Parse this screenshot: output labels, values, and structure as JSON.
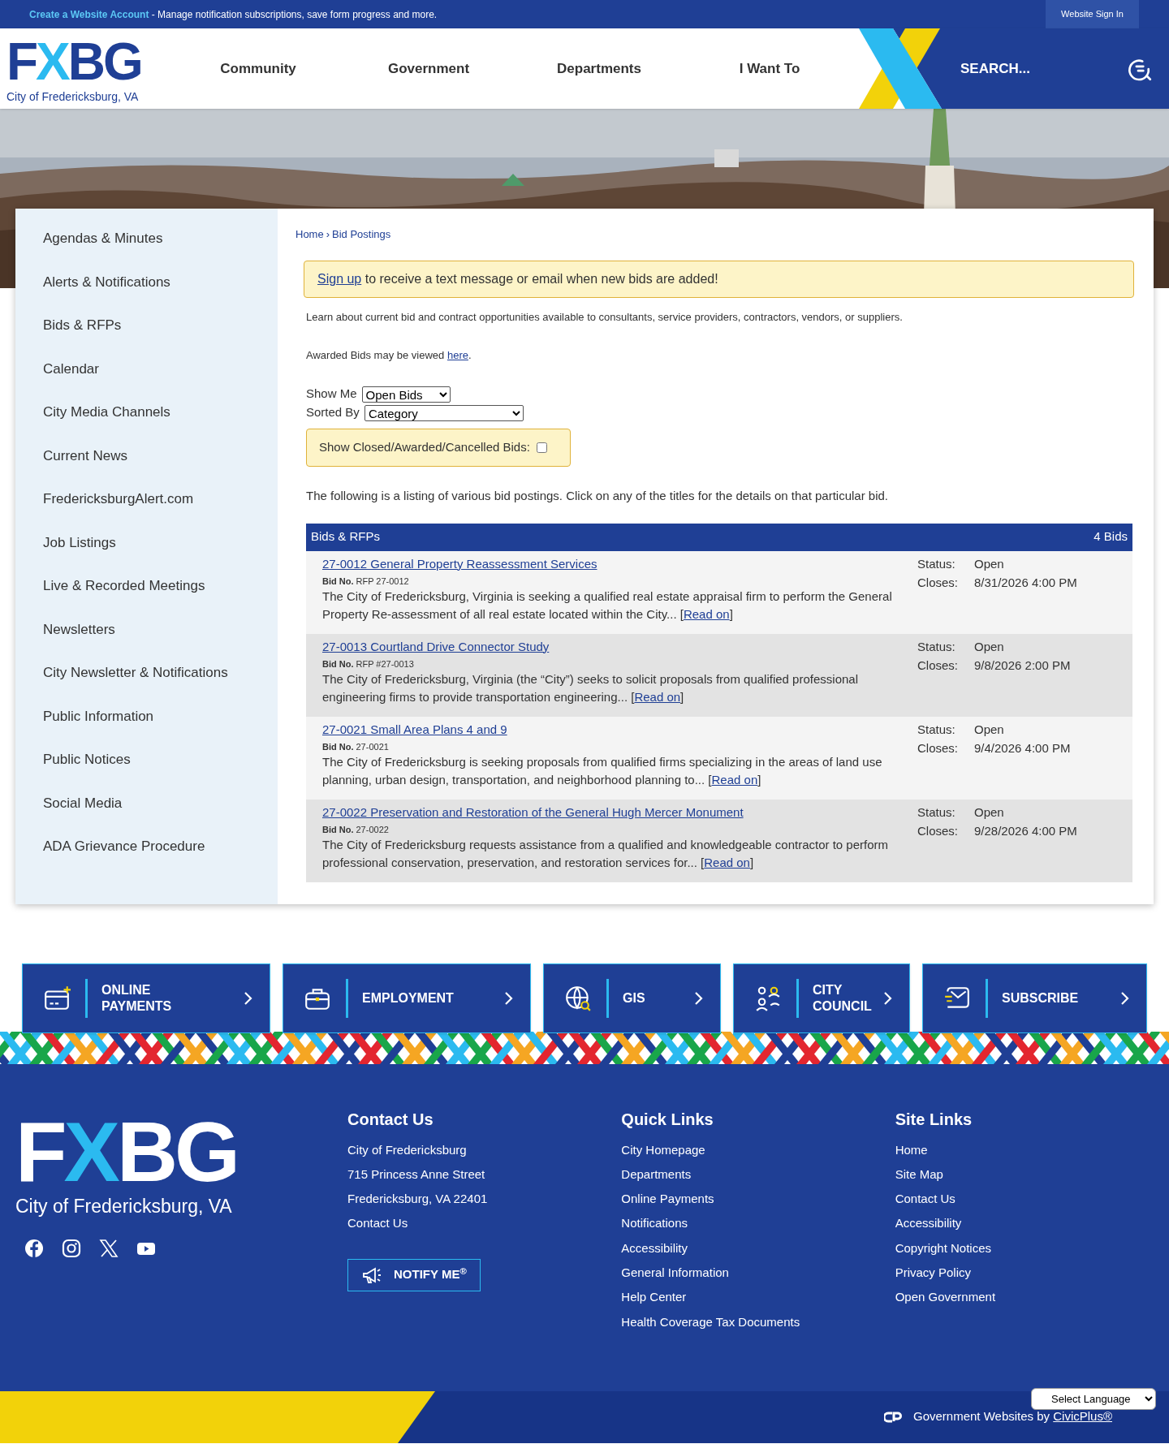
{
  "top_bar": {
    "link": "Create a Website Account",
    "text": " - Manage notification subscriptions, save form progress and more.",
    "button": "Website Sign In"
  },
  "header": {
    "logo": {
      "left": "F",
      "accent": "X",
      "right": "BG",
      "caption": "City of Fredericksburg, VA"
    },
    "nav": [
      "Community",
      "Government",
      "Departments",
      "I Want To"
    ],
    "search": {
      "placeholder": "SEARCH..."
    }
  },
  "sidebar": {
    "items": [
      "Agendas & Minutes",
      "Alerts & Notifications",
      "Bids & RFPs",
      "Calendar",
      "City Media Channels",
      "Current News",
      "FredericksburgAlert.com",
      "Job Listings",
      "Live & Recorded Meetings",
      "Newsletters",
      "City Newsletter & Notifications",
      "Public Information",
      "Public Notices",
      "Social Media",
      "ADA Grievance Procedure"
    ]
  },
  "breadcrumb": {
    "items": [
      "Home",
      "Bid Postings"
    ],
    "separator": "›"
  },
  "alert": {
    "link": "Sign up",
    "text": " to receive a text message or email when new bids are added!"
  },
  "intro": "Learn about current bid and contract opportunities available to consultants, service providers, contractors, vendors, or suppliers.",
  "awarded": {
    "text": "Awarded Bids may be viewed ",
    "link": "here",
    "end": "."
  },
  "filters": [
    {
      "label": "Show Me",
      "value": "Open Bids"
    },
    {
      "label": "Sorted By",
      "value": "Category"
    }
  ],
  "show_closed": {
    "label": "Show Closed/Awarded/Cancelled Bids:",
    "checked": false
  },
  "listing_note": "The following is a listing of various bid postings. Click on any of the titles for the details on that particular bid.",
  "bids_table": {
    "title": "Bids & RFPs",
    "count": "4 Bids",
    "rows": [
      {
        "title": "27-0012 General Property Reassessment Services",
        "bid_no_label": "Bid No.",
        "bid_no": "RFP 27-0012",
        "description": "The City of Fredericksburg, Virginia is seeking a qualified real estate appraisal firm to perform the General Property Re-assessment of all real estate located within the City...",
        "read_on": {
          "before": "[",
          "link": "Read on",
          "after": "]"
        },
        "status_label": "Status:",
        "status": "Open",
        "closes_label": "Closes:",
        "closes": "8/31/2026 4:00 PM"
      },
      {
        "title": "27-0013 Courtland Drive Connector Study",
        "bid_no_label": "Bid No.",
        "bid_no": "RFP #27-0013",
        "description": "The City of Fredericksburg, Virginia (the “City”) seeks to solicit proposals from qualified professional engineering firms to provide transportation engineering...",
        "read_on": {
          "before": "[",
          "link": "Read on",
          "after": "]"
        },
        "status_label": "Status:",
        "status": "Open",
        "closes_label": "Closes:",
        "closes": "9/8/2026 2:00 PM"
      },
      {
        "title": "27-0021 Small Area Plans 4 and 9",
        "bid_no_label": "Bid No.",
        "bid_no": "27-0021",
        "description": "The City of Fredericksburg is seeking proposals from qualified firms specializing in the areas of land use planning, urban design, transportation, and neighborhood planning to...",
        "read_on": {
          "before": "[",
          "link": "Read on",
          "after": "]"
        },
        "status_label": "Status:",
        "status": "Open",
        "closes_label": "Closes:",
        "closes": "9/4/2026 4:00 PM"
      },
      {
        "title": "27-0022 Preservation and Restoration of the General Hugh Mercer Monument",
        "bid_no_label": "Bid No.",
        "bid_no": "27-0022",
        "description": "The City of Fredericksburg requests assistance from a qualified and knowledgeable contractor to perform professional conservation, preservation, and restoration services for...",
        "read_on": {
          "before": "[",
          "link": "Read on",
          "after": "]"
        },
        "status_label": "Status:",
        "status": "Open",
        "closes_label": "Closes:",
        "closes": "9/28/2026 4:00 PM"
      }
    ]
  },
  "quick_links": [
    {
      "kind": "payments",
      "label": "ONLINE PAYMENTS"
    },
    {
      "kind": "employment",
      "label": "EMPLOYMENT"
    },
    {
      "kind": "gis",
      "label": "GIS"
    },
    {
      "kind": "council",
      "label": "CITY COUNCIL"
    },
    {
      "kind": "subscribe",
      "label": "SUBSCRIBE"
    }
  ],
  "footer": {
    "logo": {
      "left": "F",
      "accent": "X",
      "right": "BG",
      "caption": "City of Fredericksburg, VA"
    },
    "columns": [
      {
        "heading": "Contact Us",
        "links": [
          "City of Fredericksburg",
          "715 Princess Anne Street",
          "Fredericksburg, VA 22401",
          "Contact Us"
        ]
      },
      {
        "heading": "Quick Links",
        "links": [
          "City Homepage",
          "Departments",
          "Online Payments",
          "Notifications",
          "Accessibility",
          "General Information",
          "Help Center",
          "Health Coverage Tax Documents"
        ]
      },
      {
        "heading": "Site Links",
        "links": [
          "Home",
          "Site Map",
          "Contact Us",
          "Accessibility",
          "Copyright Notices",
          "Privacy Policy",
          "Open Government"
        ]
      }
    ],
    "notify_button": "NOTIFY ME$^{®}$"
  },
  "bottom_bar": {
    "text": "Government Websites by ",
    "link": "CivicPlus®",
    "translate": "Select Language"
  }
}
